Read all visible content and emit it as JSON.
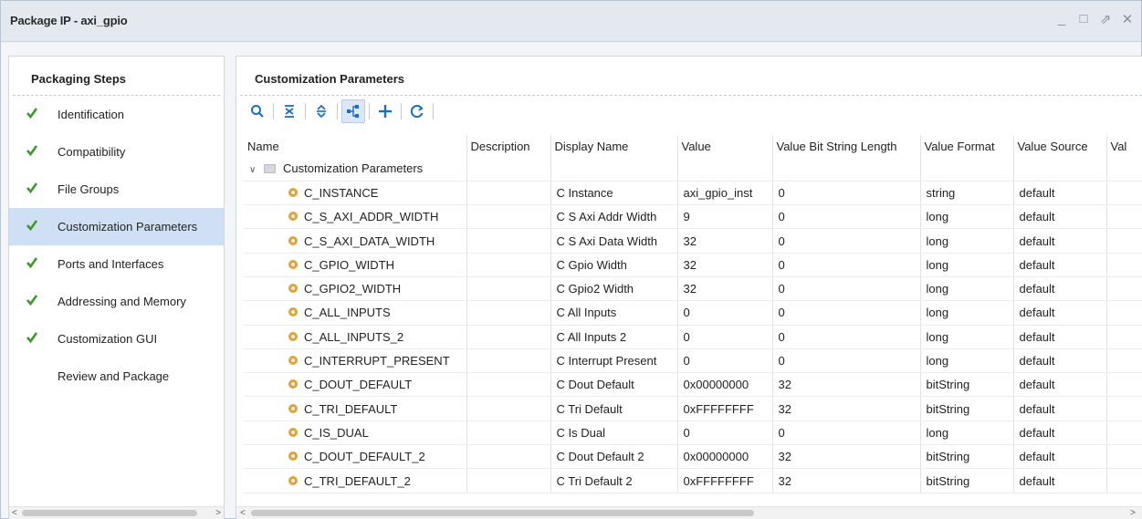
{
  "window": {
    "title": "Package IP - axi_gpio",
    "controls": [
      "_",
      "□",
      "⇗",
      "✕"
    ]
  },
  "left": {
    "header": "Packaging Steps",
    "steps": [
      {
        "label": "Identification",
        "done": true
      },
      {
        "label": "Compatibility",
        "done": true
      },
      {
        "label": "File Groups",
        "done": true
      },
      {
        "label": "Customization Parameters",
        "done": true,
        "selected": true
      },
      {
        "label": "Ports and Interfaces",
        "done": true
      },
      {
        "label": "Addressing and Memory",
        "done": true
      },
      {
        "label": "Customization GUI",
        "done": true
      },
      {
        "label": "Review and Package",
        "done": false
      }
    ],
    "scroll_left": "<",
    "scroll_right": ">"
  },
  "right": {
    "header": "Customization Parameters",
    "toolbar": [
      "search-icon",
      "collapse-all-icon",
      "expand-all-icon",
      "hierarchy-icon",
      "add-icon",
      "refresh-icon"
    ],
    "columns": [
      "Name",
      "Description",
      "Display Name",
      "Value",
      "Value Bit String Length",
      "Value Format",
      "Value Source",
      "Val"
    ],
    "group": "Customization Parameters",
    "rows": [
      [
        "C_INSTANCE",
        "",
        "C Instance",
        "axi_gpio_inst",
        "0",
        "string",
        "default"
      ],
      [
        "C_S_AXI_ADDR_WIDTH",
        "",
        "C S Axi Addr Width",
        "9",
        "0",
        "long",
        "default"
      ],
      [
        "C_S_AXI_DATA_WIDTH",
        "",
        "C S Axi Data Width",
        "32",
        "0",
        "long",
        "default"
      ],
      [
        "C_GPIO_WIDTH",
        "",
        "C Gpio Width",
        "32",
        "0",
        "long",
        "default"
      ],
      [
        "C_GPIO2_WIDTH",
        "",
        "C Gpio2 Width",
        "32",
        "0",
        "long",
        "default"
      ],
      [
        "C_ALL_INPUTS",
        "",
        "C All Inputs",
        "0",
        "0",
        "long",
        "default"
      ],
      [
        "C_ALL_INPUTS_2",
        "",
        "C All Inputs 2",
        "0",
        "0",
        "long",
        "default"
      ],
      [
        "C_INTERRUPT_PRESENT",
        "",
        "C Interrupt Present",
        "0",
        "0",
        "long",
        "default"
      ],
      [
        "C_DOUT_DEFAULT",
        "",
        "C Dout Default",
        "0x00000000",
        "32",
        "bitString",
        "default"
      ],
      [
        "C_TRI_DEFAULT",
        "",
        "C Tri Default",
        "0xFFFFFFFF",
        "32",
        "bitString",
        "default"
      ],
      [
        "C_IS_DUAL",
        "",
        "C Is Dual",
        "0",
        "0",
        "long",
        "default"
      ],
      [
        "C_DOUT_DEFAULT_2",
        "",
        "C Dout Default 2",
        "0x00000000",
        "32",
        "bitString",
        "default"
      ],
      [
        "C_TRI_DEFAULT_2",
        "",
        "C Tri Default 2",
        "0xFFFFFFFF",
        "32",
        "bitString",
        "default"
      ]
    ],
    "scroll_left": "<",
    "scroll_right": ">"
  },
  "colors": {
    "check": "#3a9a2a",
    "selected_row": "#cfe0f5",
    "icon_blue": "#1a6fc4",
    "gear": "#e0a23b"
  }
}
